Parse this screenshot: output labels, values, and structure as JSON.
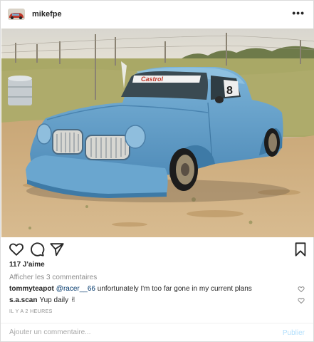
{
  "post": {
    "username": "mikefpe",
    "more_label": "•••",
    "likes": "117 J'aime",
    "view_comments": "Afficher les 3 commentaires",
    "comments": [
      {
        "user": "tommyteapot",
        "mention": "@racer__66",
        "text": " unfortunately I'm too far gone in my current plans"
      },
      {
        "user": "s.a.scan",
        "mention": "",
        "text": "Yup daily ✌"
      }
    ],
    "timestamp": "IL Y A 2 HEURES",
    "add_comment_placeholder": "Ajouter un commentaire...",
    "publish_label": "Publier",
    "photo_text": {
      "windshield": "Castrol",
      "door_number": "8"
    }
  },
  "icons": [
    "avatar",
    "more-options-icon",
    "heart-icon",
    "comment-icon",
    "share-icon",
    "bookmark-icon",
    "comment-heart-icon"
  ],
  "colors": {
    "car": "#5f9bc6",
    "link": "#00376b",
    "publish": "#b2dffc",
    "muted": "#8e8e8e"
  }
}
